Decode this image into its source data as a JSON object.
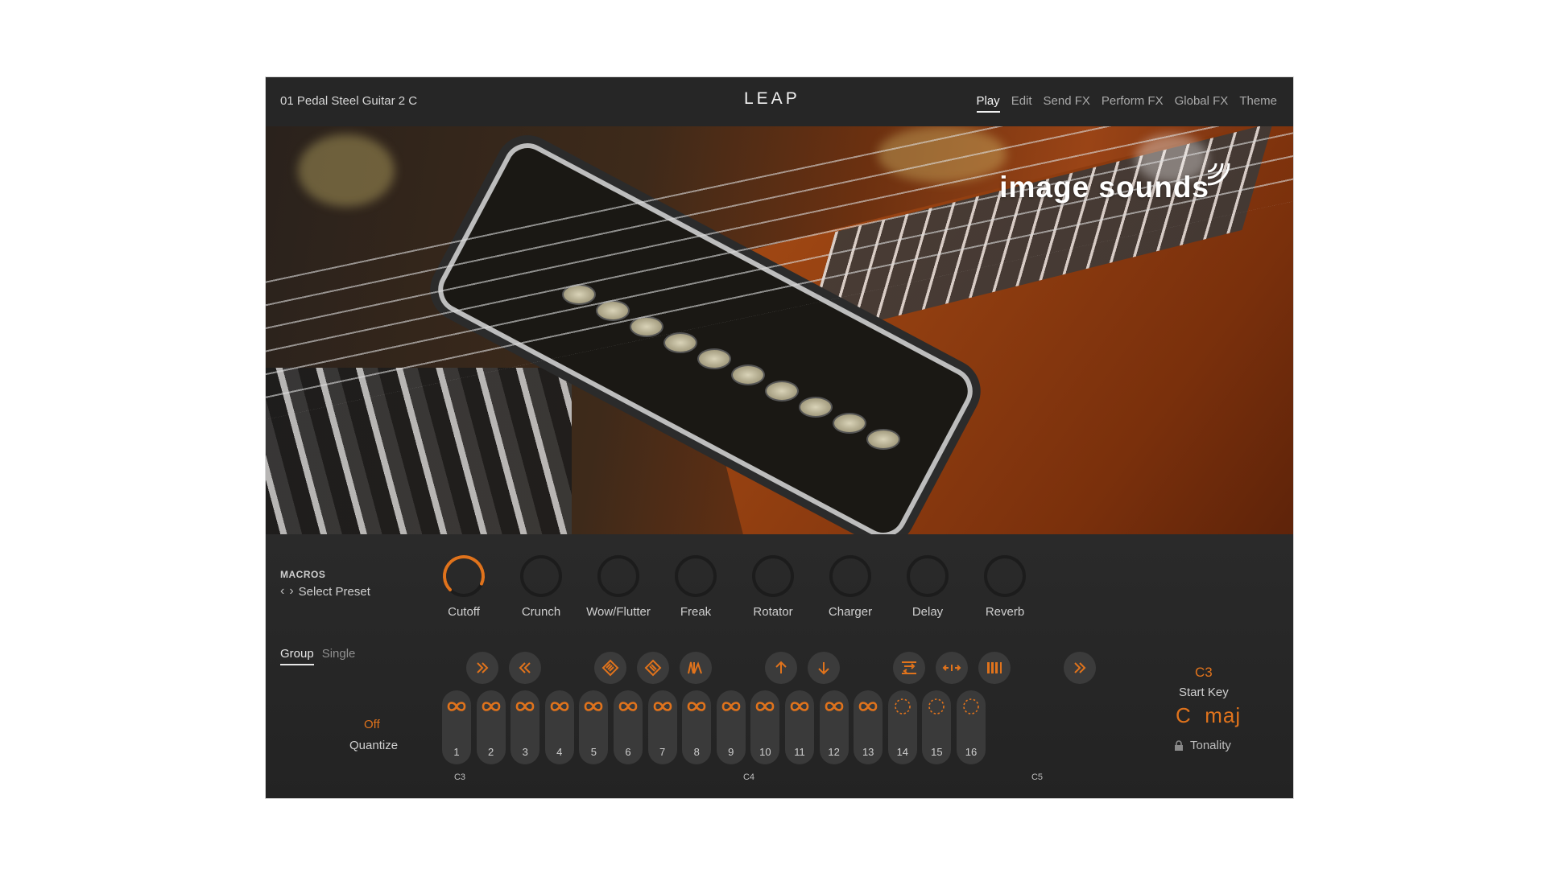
{
  "header": {
    "preset_name": "01 Pedal Steel Guitar 2 C",
    "logo": "LEAP",
    "nav": [
      "Play",
      "Edit",
      "Send FX",
      "Perform FX",
      "Global FX",
      "Theme"
    ],
    "active_nav": "Play"
  },
  "banner": {
    "brand": "image sounds"
  },
  "macros": {
    "title": "MACROS",
    "select_label": "Select Preset",
    "knobs": [
      {
        "label": "Cutoff",
        "value": 0.92
      },
      {
        "label": "Crunch",
        "value": 0
      },
      {
        "label": "Wow/Flutter",
        "value": 0
      },
      {
        "label": "Freak",
        "value": 0
      },
      {
        "label": "Rotator",
        "value": 0
      },
      {
        "label": "Charger",
        "value": 0
      },
      {
        "label": "Delay",
        "value": 0
      },
      {
        "label": "Reverb",
        "value": 0
      }
    ]
  },
  "mode": {
    "items": [
      "Group",
      "Single"
    ],
    "active": "Group"
  },
  "quantize": {
    "value": "Off",
    "label": "Quantize"
  },
  "controls": [
    {
      "icon": "fast-forward-icon"
    },
    {
      "icon": "rewind-icon"
    },
    {
      "icon": "shuffle-icon"
    },
    {
      "icon": "shuffle-alt-icon"
    },
    {
      "icon": "envelope-icon"
    },
    {
      "icon": "arrow-up-icon"
    },
    {
      "icon": "arrow-down-icon"
    },
    {
      "icon": "swap-icon"
    },
    {
      "icon": "stretch-icon"
    },
    {
      "icon": "bars-icon"
    },
    {
      "icon": "skip-forward-icon"
    }
  ],
  "pads": [
    {
      "num": "1",
      "icon": "loop-icon"
    },
    {
      "num": "2",
      "icon": "loop-icon"
    },
    {
      "num": "3",
      "icon": "loop-icon"
    },
    {
      "num": "4",
      "icon": "loop-icon"
    },
    {
      "num": "5",
      "icon": "loop-icon"
    },
    {
      "num": "6",
      "icon": "loop-icon"
    },
    {
      "num": "7",
      "icon": "loop-icon"
    },
    {
      "num": "8",
      "icon": "loop-icon"
    },
    {
      "num": "9",
      "icon": "loop-icon"
    },
    {
      "num": "10",
      "icon": "loop-icon"
    },
    {
      "num": "11",
      "icon": "loop-icon"
    },
    {
      "num": "12",
      "icon": "loop-icon"
    },
    {
      "num": "13",
      "icon": "loop-icon"
    },
    {
      "num": "14",
      "icon": "empty-circle-icon"
    },
    {
      "num": "15",
      "icon": "empty-circle-icon"
    },
    {
      "num": "16",
      "icon": "empty-circle-icon"
    }
  ],
  "octaves": [
    "C3",
    "C4",
    "C5"
  ],
  "start_key": {
    "value": "C3",
    "label": "Start Key"
  },
  "tonality": {
    "value": "C  maj",
    "label": "Tonality"
  },
  "colors": {
    "accent": "#e0731c",
    "background": "#262626",
    "pad": "#3a3a3a"
  }
}
